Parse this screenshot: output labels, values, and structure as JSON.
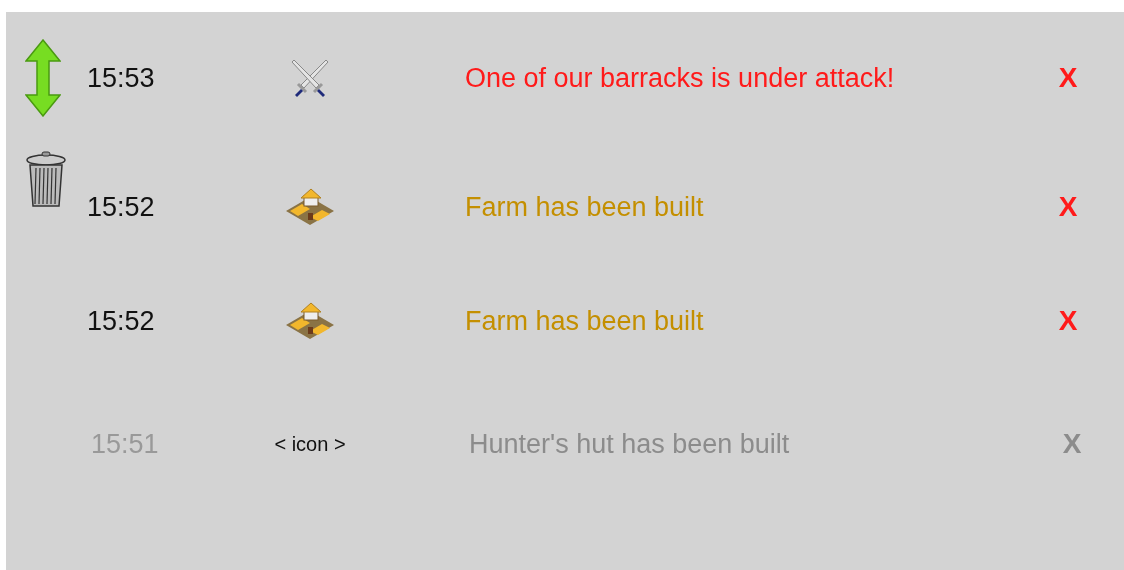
{
  "messages": [
    {
      "handle": {
        "kind": "move"
      },
      "time": "15:53",
      "icon": {
        "kind": "swords"
      },
      "text": "One of our barracks is under attack!",
      "kind": "urgent",
      "close": "X"
    },
    {
      "handle": {
        "kind": "delete"
      },
      "time": "15:52",
      "icon": {
        "kind": "farm"
      },
      "text": "Farm has been built",
      "kind": "notice",
      "close": "X"
    },
    {
      "time": "15:52",
      "icon": {
        "kind": "farm"
      },
      "text": "Farm has been built",
      "kind": "notice",
      "close": "X"
    },
    {
      "time": "15:51",
      "icon_text": "< icon >",
      "text": "Hunter's hut has been built",
      "kind": "faded",
      "close": "X"
    }
  ]
}
